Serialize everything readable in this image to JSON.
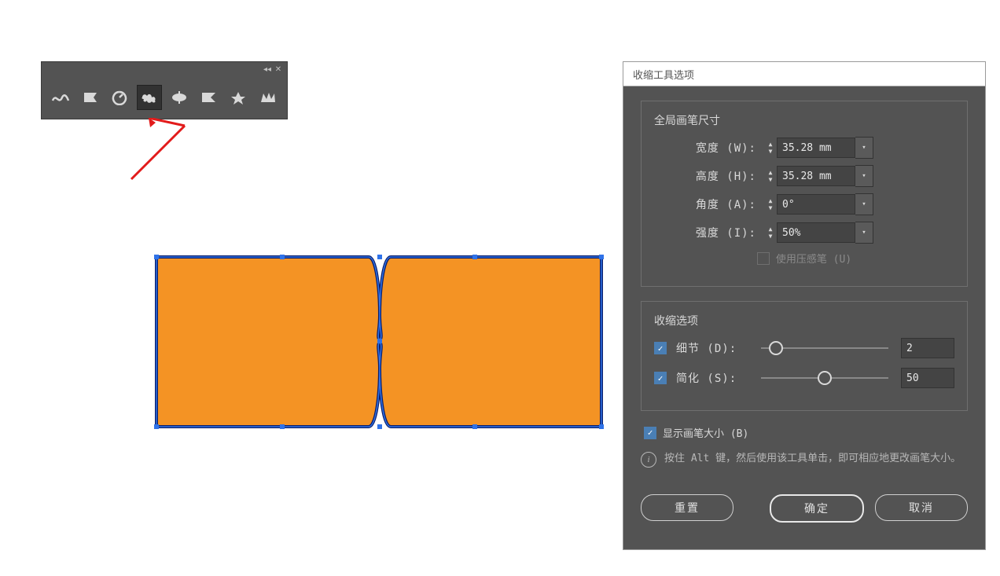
{
  "toolPanel": {
    "title": "",
    "tools": [
      {
        "name": "warp-tool"
      },
      {
        "name": "twirl-tool"
      },
      {
        "name": "pucker-tool"
      },
      {
        "name": "bloat-tool"
      },
      {
        "name": "scallop-tool"
      },
      {
        "name": "crystallize-tool"
      },
      {
        "name": "wrinkle-tool"
      },
      {
        "name": "crown-tool"
      }
    ],
    "activeIndex": 3
  },
  "dialog": {
    "title": "收缩工具选项",
    "brushSection": {
      "heading": "全局画笔尺寸",
      "width": {
        "label": "宽度 (W):",
        "value": "35.28 mm"
      },
      "height": {
        "label": "高度 (H):",
        "value": "35.28 mm"
      },
      "angle": {
        "label": "角度 (A):",
        "value": "0°"
      },
      "intensity": {
        "label": "强度 (I):",
        "value": "50%"
      },
      "pressure": {
        "label": "使用压感笔 (U)",
        "checked": false,
        "enabled": false
      }
    },
    "optionsSection": {
      "heading": "收缩选项",
      "detail": {
        "label": "细节 (D):",
        "value": "2",
        "checked": true,
        "pos": 12
      },
      "simplify": {
        "label": "简化 (S):",
        "value": "50",
        "checked": true,
        "pos": 50
      }
    },
    "showBrush": {
      "label": "显示画笔大小 (B)",
      "checked": true
    },
    "hint": "按住 Alt 键，然后使用该工具单击，即可相应地更改画笔大小。",
    "buttons": {
      "reset": "重置",
      "ok": "确定",
      "cancel": "取消"
    }
  },
  "colors": {
    "shapeFill": "#f49324",
    "shapeStroke": "#0b1f6b",
    "selection": "#2a62d6"
  }
}
